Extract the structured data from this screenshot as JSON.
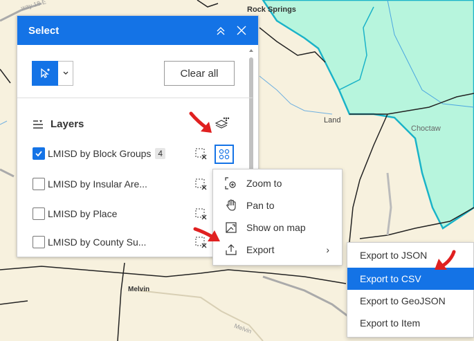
{
  "map": {
    "labels": [
      "Rock Springs",
      "Land",
      "Choctaw",
      "Melvin",
      "Melvin",
      "way 18 E"
    ]
  },
  "panel": {
    "title": "Select",
    "clear_label": "Clear all",
    "layers_title": "Layers",
    "layers": [
      {
        "name": "LMISD by Block Groups",
        "checked": true,
        "count": "4"
      },
      {
        "name": "LMISD by Insular Are...",
        "checked": false
      },
      {
        "name": "LMISD by Place",
        "checked": false
      },
      {
        "name": "LMISD by County Su...",
        "checked": false
      }
    ]
  },
  "menu": {
    "items": [
      {
        "label": "Zoom to",
        "icon": "zoom-to-icon"
      },
      {
        "label": "Pan to",
        "icon": "pan-hand-icon"
      },
      {
        "label": "Show on map",
        "icon": "show-on-map-icon"
      },
      {
        "label": "Export",
        "icon": "export-icon",
        "chevron": "›"
      }
    ]
  },
  "submenu": {
    "items": [
      {
        "label": "Export to JSON"
      },
      {
        "label": "Export to CSV",
        "highlighted": true
      },
      {
        "label": "Export to GeoJSON"
      },
      {
        "label": "Export to Item"
      }
    ]
  },
  "colors": {
    "accent": "#1473e6",
    "map_bg": "#f7f1de",
    "water_fill": "#b7f5dd",
    "boundary_cyan": "#1ab3c8",
    "annotation_red": "#e02020"
  }
}
